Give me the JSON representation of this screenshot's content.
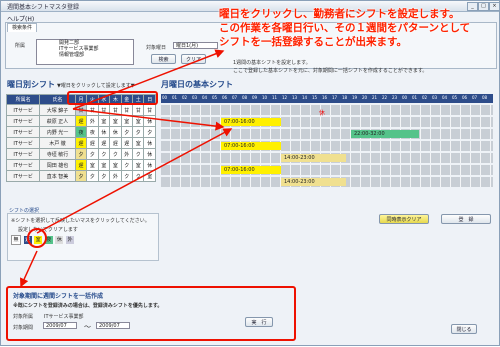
{
  "window": {
    "title": "週間基本シフトマスタ登録"
  },
  "menu": {
    "help": "ヘルプ(H)"
  },
  "search": {
    "tab": "検索条件",
    "dept_label": "所属",
    "dept_items": [
      "開発二部",
      "ITサービス事業部",
      "情報管理部"
    ],
    "target_label": "対象曜日",
    "target_value": "曜日1(月)",
    "search_button": "検索",
    "clear_button": "クリア"
  },
  "overlay": {
    "line1": "曜日をクリックし、勤務者にシフトを設定します。",
    "line2": "この作業を各曜日行い、その１週間をパターンとして",
    "line3": "シフトを一括登録することが出来ます。"
  },
  "weekday_section": {
    "title": "曜日別シフト",
    "hint": "▼曜日をクリックして設定します▼",
    "columns": [
      "所属名",
      "氏名",
      "月",
      "火",
      "水",
      "木",
      "金",
      "土",
      "日"
    ],
    "rows": [
      {
        "dept": "ITサービ",
        "name": "大塚 錦子",
        "days": [
          "甘",
          "甘",
          "甘",
          "甘",
          "甘",
          "甘",
          "甘"
        ]
      },
      {
        "dept": "ITサービ",
        "name": "萩原 正人",
        "days": [
          "遅",
          "外",
          "室",
          "室",
          "室",
          "室",
          "休"
        ]
      },
      {
        "dept": "ITサービ",
        "name": "内野 光一",
        "days": [
          "夜",
          "夜",
          "休",
          "休",
          "夕",
          "夕",
          "夕"
        ]
      },
      {
        "dept": "ITサービ",
        "name": "木戸 徹",
        "days": [
          "遅",
          "遅",
          "遅",
          "遅",
          "遅",
          "室",
          "休"
        ]
      },
      {
        "dept": "ITサービ",
        "name": "寺垣 敏行",
        "days": [
          "夕",
          "夕",
          "ク",
          "ク",
          "外",
          "ク",
          "休"
        ]
      },
      {
        "dept": "ITサービ",
        "name": "岡田 雄也",
        "days": [
          "遅",
          "室",
          "室",
          "室",
          "ク",
          "室",
          "休"
        ]
      },
      {
        "dept": "ITサービ",
        "name": "直本 智美",
        "days": [
          "夕",
          "夕",
          "夕",
          "外",
          "ク",
          "ク",
          "室"
        ]
      }
    ]
  },
  "basic_section": {
    "title": "月曜日の基本シフト",
    "note1": "1週間の基本シフトを設定します。",
    "note2": "ここで登録した基本シフトを元に、対象期間に一括シフトを作成することができます。",
    "hours": [
      "00",
      "01",
      "02",
      "03",
      "04",
      "05",
      "06",
      "07",
      "08",
      "09",
      "10",
      "11",
      "12",
      "13",
      "14",
      "15",
      "16",
      "17",
      "18",
      "19",
      "20",
      "21",
      "22",
      "23",
      "00",
      "01",
      "02",
      "03",
      "04",
      "05",
      "06",
      "07",
      "08"
    ],
    "mark": "休",
    "shifts": [
      {
        "row": 1,
        "label": "07:00-16:00",
        "color": "#fff000"
      },
      {
        "row": 2,
        "label": "22:00-32:00",
        "color": "#55c38a"
      },
      {
        "row": 3,
        "label": "07:00-16:00",
        "color": "#fff000"
      },
      {
        "row": 4,
        "label": "14:00-23:00",
        "color": "#f0e090"
      },
      {
        "row": 5,
        "label": "07:00-16:00",
        "color": "#fff000"
      },
      {
        "row": 6,
        "label": "14:00-23:00",
        "color": "#f0e090"
      }
    ]
  },
  "shift_select": {
    "title": "シフトの選択",
    "hint": "※シフトを選択して反映したいマスをクリックしてください。",
    "sub": "設定しないでクリアします",
    "none_label": "無",
    "options": [
      "遅",
      "室",
      "夜",
      "休",
      "外"
    ]
  },
  "buttons": {
    "display_clear": "同時表示クリア",
    "register": "登　録",
    "execute": "実　行",
    "close": "閉じる"
  },
  "bulk": {
    "title": "対象期間に週間シフトを一括作成",
    "note": "※既にシフトを登録済みの場合は、登録済みシフトを優先します。",
    "dept_label": "対象所属",
    "dept_value": "ITサービス事業部",
    "period_label": "対象期間",
    "from": "2009/07",
    "to": "2009/07",
    "tilde": "～"
  },
  "colors": {
    "accent": "#2d4c8a",
    "highlight": "#ee1100",
    "early": "#fff000",
    "night": "#55c38a",
    "late": "#f0e090"
  }
}
